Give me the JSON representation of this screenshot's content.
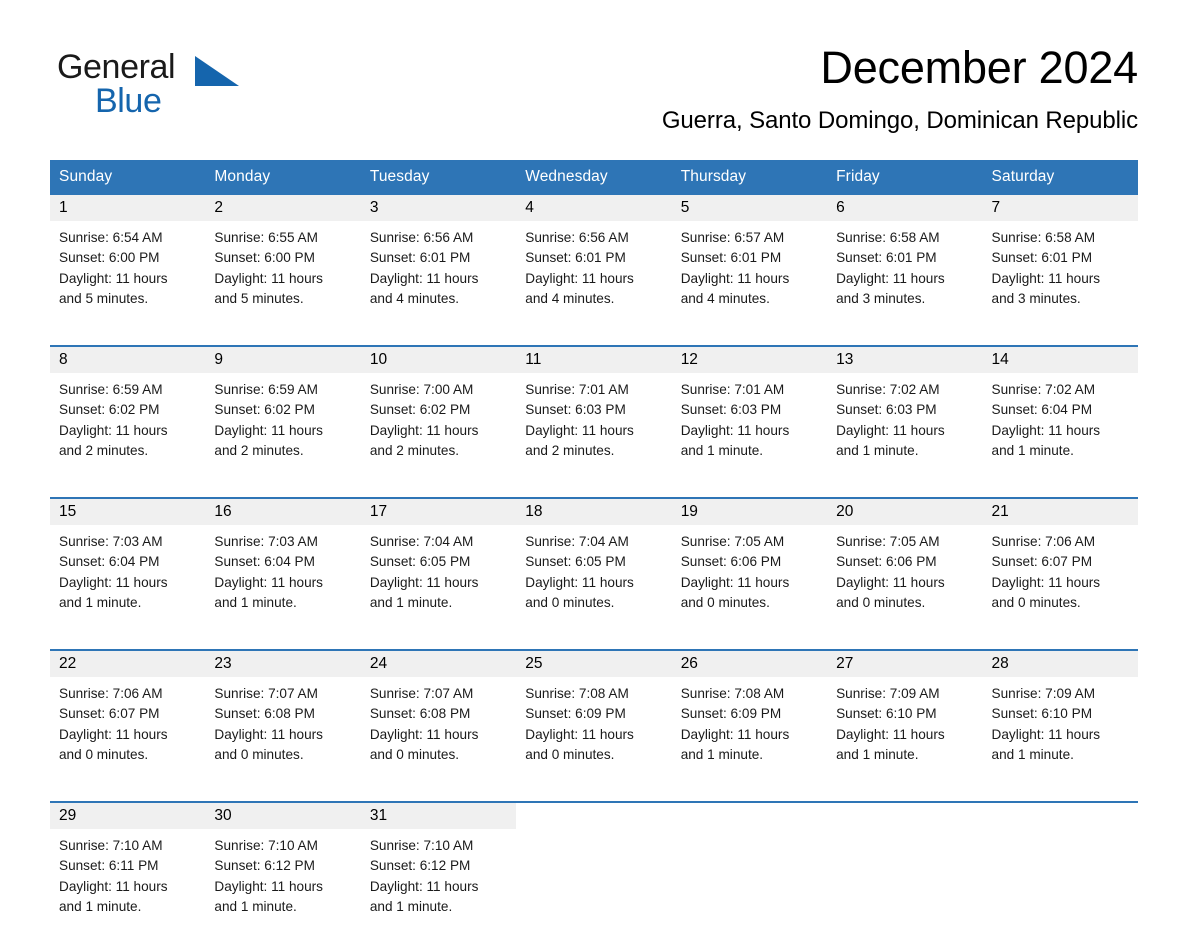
{
  "logo": {
    "word_top": "General",
    "word_bottom": "Blue",
    "triangle_icon": "triangle-logo-icon",
    "brand_color": "#1565ad"
  },
  "header": {
    "month_title": "December 2024",
    "location": "Guerra, Santo Domingo, Dominican Republic"
  },
  "theme": {
    "header_blue": "#2e75b6",
    "daynum_band": "#f0f0f0",
    "rule_blue": "#2e75b6",
    "page_background": "#ffffff"
  },
  "weekday_headers": [
    "Sunday",
    "Monday",
    "Tuesday",
    "Wednesday",
    "Thursday",
    "Friday",
    "Saturday"
  ],
  "weeks": [
    [
      {
        "day": "1",
        "sunrise": "Sunrise: 6:54 AM",
        "sunset": "Sunset: 6:00 PM",
        "daylight1": "Daylight: 11 hours",
        "daylight2": "and 5 minutes."
      },
      {
        "day": "2",
        "sunrise": "Sunrise: 6:55 AM",
        "sunset": "Sunset: 6:00 PM",
        "daylight1": "Daylight: 11 hours",
        "daylight2": "and 5 minutes."
      },
      {
        "day": "3",
        "sunrise": "Sunrise: 6:56 AM",
        "sunset": "Sunset: 6:01 PM",
        "daylight1": "Daylight: 11 hours",
        "daylight2": "and 4 minutes."
      },
      {
        "day": "4",
        "sunrise": "Sunrise: 6:56 AM",
        "sunset": "Sunset: 6:01 PM",
        "daylight1": "Daylight: 11 hours",
        "daylight2": "and 4 minutes."
      },
      {
        "day": "5",
        "sunrise": "Sunrise: 6:57 AM",
        "sunset": "Sunset: 6:01 PM",
        "daylight1": "Daylight: 11 hours",
        "daylight2": "and 4 minutes."
      },
      {
        "day": "6",
        "sunrise": "Sunrise: 6:58 AM",
        "sunset": "Sunset: 6:01 PM",
        "daylight1": "Daylight: 11 hours",
        "daylight2": "and 3 minutes."
      },
      {
        "day": "7",
        "sunrise": "Sunrise: 6:58 AM",
        "sunset": "Sunset: 6:01 PM",
        "daylight1": "Daylight: 11 hours",
        "daylight2": "and 3 minutes."
      }
    ],
    [
      {
        "day": "8",
        "sunrise": "Sunrise: 6:59 AM",
        "sunset": "Sunset: 6:02 PM",
        "daylight1": "Daylight: 11 hours",
        "daylight2": "and 2 minutes."
      },
      {
        "day": "9",
        "sunrise": "Sunrise: 6:59 AM",
        "sunset": "Sunset: 6:02 PM",
        "daylight1": "Daylight: 11 hours",
        "daylight2": "and 2 minutes."
      },
      {
        "day": "10",
        "sunrise": "Sunrise: 7:00 AM",
        "sunset": "Sunset: 6:02 PM",
        "daylight1": "Daylight: 11 hours",
        "daylight2": "and 2 minutes."
      },
      {
        "day": "11",
        "sunrise": "Sunrise: 7:01 AM",
        "sunset": "Sunset: 6:03 PM",
        "daylight1": "Daylight: 11 hours",
        "daylight2": "and 2 minutes."
      },
      {
        "day": "12",
        "sunrise": "Sunrise: 7:01 AM",
        "sunset": "Sunset: 6:03 PM",
        "daylight1": "Daylight: 11 hours",
        "daylight2": "and 1 minute."
      },
      {
        "day": "13",
        "sunrise": "Sunrise: 7:02 AM",
        "sunset": "Sunset: 6:03 PM",
        "daylight1": "Daylight: 11 hours",
        "daylight2": "and 1 minute."
      },
      {
        "day": "14",
        "sunrise": "Sunrise: 7:02 AM",
        "sunset": "Sunset: 6:04 PM",
        "daylight1": "Daylight: 11 hours",
        "daylight2": "and 1 minute."
      }
    ],
    [
      {
        "day": "15",
        "sunrise": "Sunrise: 7:03 AM",
        "sunset": "Sunset: 6:04 PM",
        "daylight1": "Daylight: 11 hours",
        "daylight2": "and 1 minute."
      },
      {
        "day": "16",
        "sunrise": "Sunrise: 7:03 AM",
        "sunset": "Sunset: 6:04 PM",
        "daylight1": "Daylight: 11 hours",
        "daylight2": "and 1 minute."
      },
      {
        "day": "17",
        "sunrise": "Sunrise: 7:04 AM",
        "sunset": "Sunset: 6:05 PM",
        "daylight1": "Daylight: 11 hours",
        "daylight2": "and 1 minute."
      },
      {
        "day": "18",
        "sunrise": "Sunrise: 7:04 AM",
        "sunset": "Sunset: 6:05 PM",
        "daylight1": "Daylight: 11 hours",
        "daylight2": "and 0 minutes."
      },
      {
        "day": "19",
        "sunrise": "Sunrise: 7:05 AM",
        "sunset": "Sunset: 6:06 PM",
        "daylight1": "Daylight: 11 hours",
        "daylight2": "and 0 minutes."
      },
      {
        "day": "20",
        "sunrise": "Sunrise: 7:05 AM",
        "sunset": "Sunset: 6:06 PM",
        "daylight1": "Daylight: 11 hours",
        "daylight2": "and 0 minutes."
      },
      {
        "day": "21",
        "sunrise": "Sunrise: 7:06 AM",
        "sunset": "Sunset: 6:07 PM",
        "daylight1": "Daylight: 11 hours",
        "daylight2": "and 0 minutes."
      }
    ],
    [
      {
        "day": "22",
        "sunrise": "Sunrise: 7:06 AM",
        "sunset": "Sunset: 6:07 PM",
        "daylight1": "Daylight: 11 hours",
        "daylight2": "and 0 minutes."
      },
      {
        "day": "23",
        "sunrise": "Sunrise: 7:07 AM",
        "sunset": "Sunset: 6:08 PM",
        "daylight1": "Daylight: 11 hours",
        "daylight2": "and 0 minutes."
      },
      {
        "day": "24",
        "sunrise": "Sunrise: 7:07 AM",
        "sunset": "Sunset: 6:08 PM",
        "daylight1": "Daylight: 11 hours",
        "daylight2": "and 0 minutes."
      },
      {
        "day": "25",
        "sunrise": "Sunrise: 7:08 AM",
        "sunset": "Sunset: 6:09 PM",
        "daylight1": "Daylight: 11 hours",
        "daylight2": "and 0 minutes."
      },
      {
        "day": "26",
        "sunrise": "Sunrise: 7:08 AM",
        "sunset": "Sunset: 6:09 PM",
        "daylight1": "Daylight: 11 hours",
        "daylight2": "and 1 minute."
      },
      {
        "day": "27",
        "sunrise": "Sunrise: 7:09 AM",
        "sunset": "Sunset: 6:10 PM",
        "daylight1": "Daylight: 11 hours",
        "daylight2": "and 1 minute."
      },
      {
        "day": "28",
        "sunrise": "Sunrise: 7:09 AM",
        "sunset": "Sunset: 6:10 PM",
        "daylight1": "Daylight: 11 hours",
        "daylight2": "and 1 minute."
      }
    ],
    [
      {
        "day": "29",
        "sunrise": "Sunrise: 7:10 AM",
        "sunset": "Sunset: 6:11 PM",
        "daylight1": "Daylight: 11 hours",
        "daylight2": "and 1 minute."
      },
      {
        "day": "30",
        "sunrise": "Sunrise: 7:10 AM",
        "sunset": "Sunset: 6:12 PM",
        "daylight1": "Daylight: 11 hours",
        "daylight2": "and 1 minute."
      },
      {
        "day": "31",
        "sunrise": "Sunrise: 7:10 AM",
        "sunset": "Sunset: 6:12 PM",
        "daylight1": "Daylight: 11 hours",
        "daylight2": "and 1 minute."
      },
      {
        "day": "",
        "sunrise": "",
        "sunset": "",
        "daylight1": "",
        "daylight2": ""
      },
      {
        "day": "",
        "sunrise": "",
        "sunset": "",
        "daylight1": "",
        "daylight2": ""
      },
      {
        "day": "",
        "sunrise": "",
        "sunset": "",
        "daylight1": "",
        "daylight2": ""
      },
      {
        "day": "",
        "sunrise": "",
        "sunset": "",
        "daylight1": "",
        "daylight2": ""
      }
    ]
  ]
}
